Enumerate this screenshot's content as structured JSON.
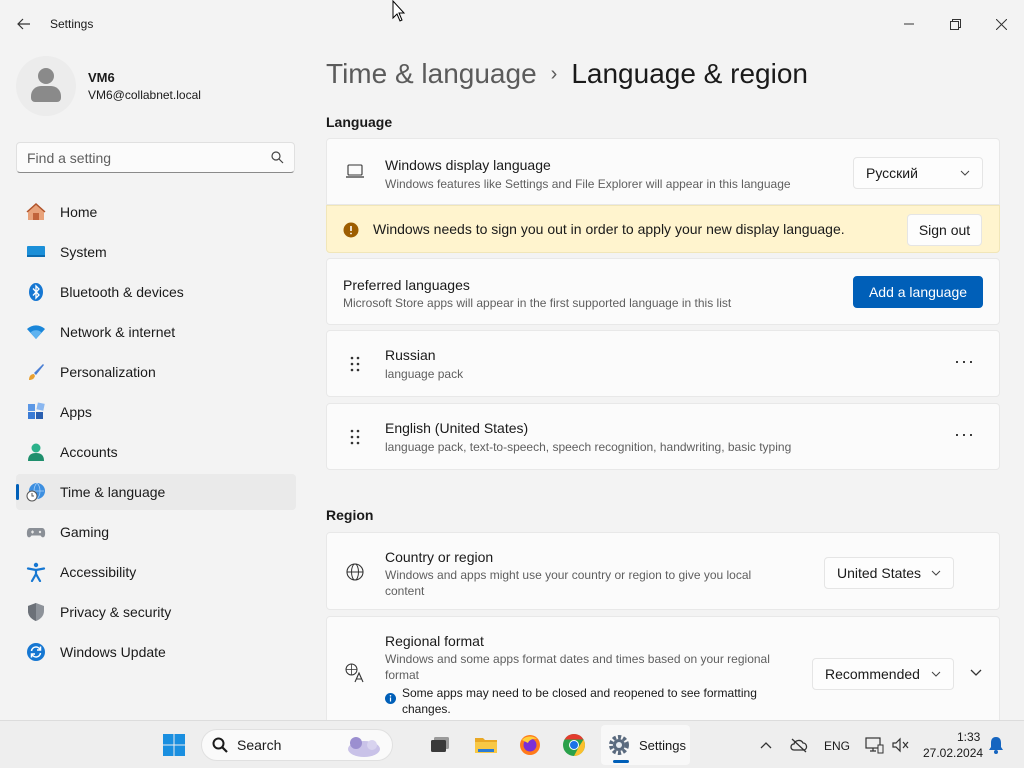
{
  "window": {
    "title": "Settings",
    "back_icon": "back-arrow-icon"
  },
  "sidebar": {
    "profile": {
      "name": "VM6",
      "email": "VM6@collabnet.local"
    },
    "search_placeholder": "Find a setting",
    "items": [
      {
        "label": "Home",
        "icon": "home-icon"
      },
      {
        "label": "System",
        "icon": "system-icon"
      },
      {
        "label": "Bluetooth & devices",
        "icon": "bluetooth-icon"
      },
      {
        "label": "Network & internet",
        "icon": "wifi-icon"
      },
      {
        "label": "Personalization",
        "icon": "brush-icon"
      },
      {
        "label": "Apps",
        "icon": "apps-icon"
      },
      {
        "label": "Accounts",
        "icon": "accounts-icon"
      },
      {
        "label": "Time & language",
        "icon": "time-language-icon",
        "active": true
      },
      {
        "label": "Gaming",
        "icon": "gaming-icon"
      },
      {
        "label": "Accessibility",
        "icon": "accessibility-icon"
      },
      {
        "label": "Privacy & security",
        "icon": "shield-icon"
      },
      {
        "label": "Windows Update",
        "icon": "update-icon"
      }
    ]
  },
  "main": {
    "breadcrumb": {
      "parent": "Time & language",
      "separator": "›",
      "current": "Language & region"
    },
    "language_section": {
      "title": "Language",
      "display_language": {
        "title": "Windows display language",
        "subtitle": "Windows features like Settings and File Explorer will appear in this language",
        "value": "Русский"
      },
      "warning": {
        "text": "Windows needs to sign you out in order to apply your new display language.",
        "button": "Sign out"
      },
      "preferred": {
        "title": "Preferred languages",
        "subtitle": "Microsoft Store apps will appear in the first supported language in this list",
        "button": "Add a language"
      },
      "languages": [
        {
          "name": "Russian",
          "detail": "language pack"
        },
        {
          "name": "English (United States)",
          "detail": "language pack, text-to-speech, speech recognition, handwriting, basic typing"
        }
      ],
      "more_glyph": "···"
    },
    "region_section": {
      "title": "Region",
      "country": {
        "title": "Country or region",
        "subtitle": "Windows and apps might use your country or region to give you local content",
        "value": "United States"
      },
      "format": {
        "title": "Regional format",
        "subtitle": "Windows and some apps format dates and times based on your regional format",
        "note": "Some apps may need to be closed and reopened to see formatting changes.",
        "value": "Recommended"
      }
    }
  },
  "taskbar": {
    "search_label": "Search",
    "settings_label": "Settings",
    "lang": "ENG",
    "time": "1:33",
    "date": "27.02.2024"
  },
  "colors": {
    "accent": "#005fb8",
    "warning_bg": "#fff4ce",
    "warning_icon": "#9d5d00"
  }
}
